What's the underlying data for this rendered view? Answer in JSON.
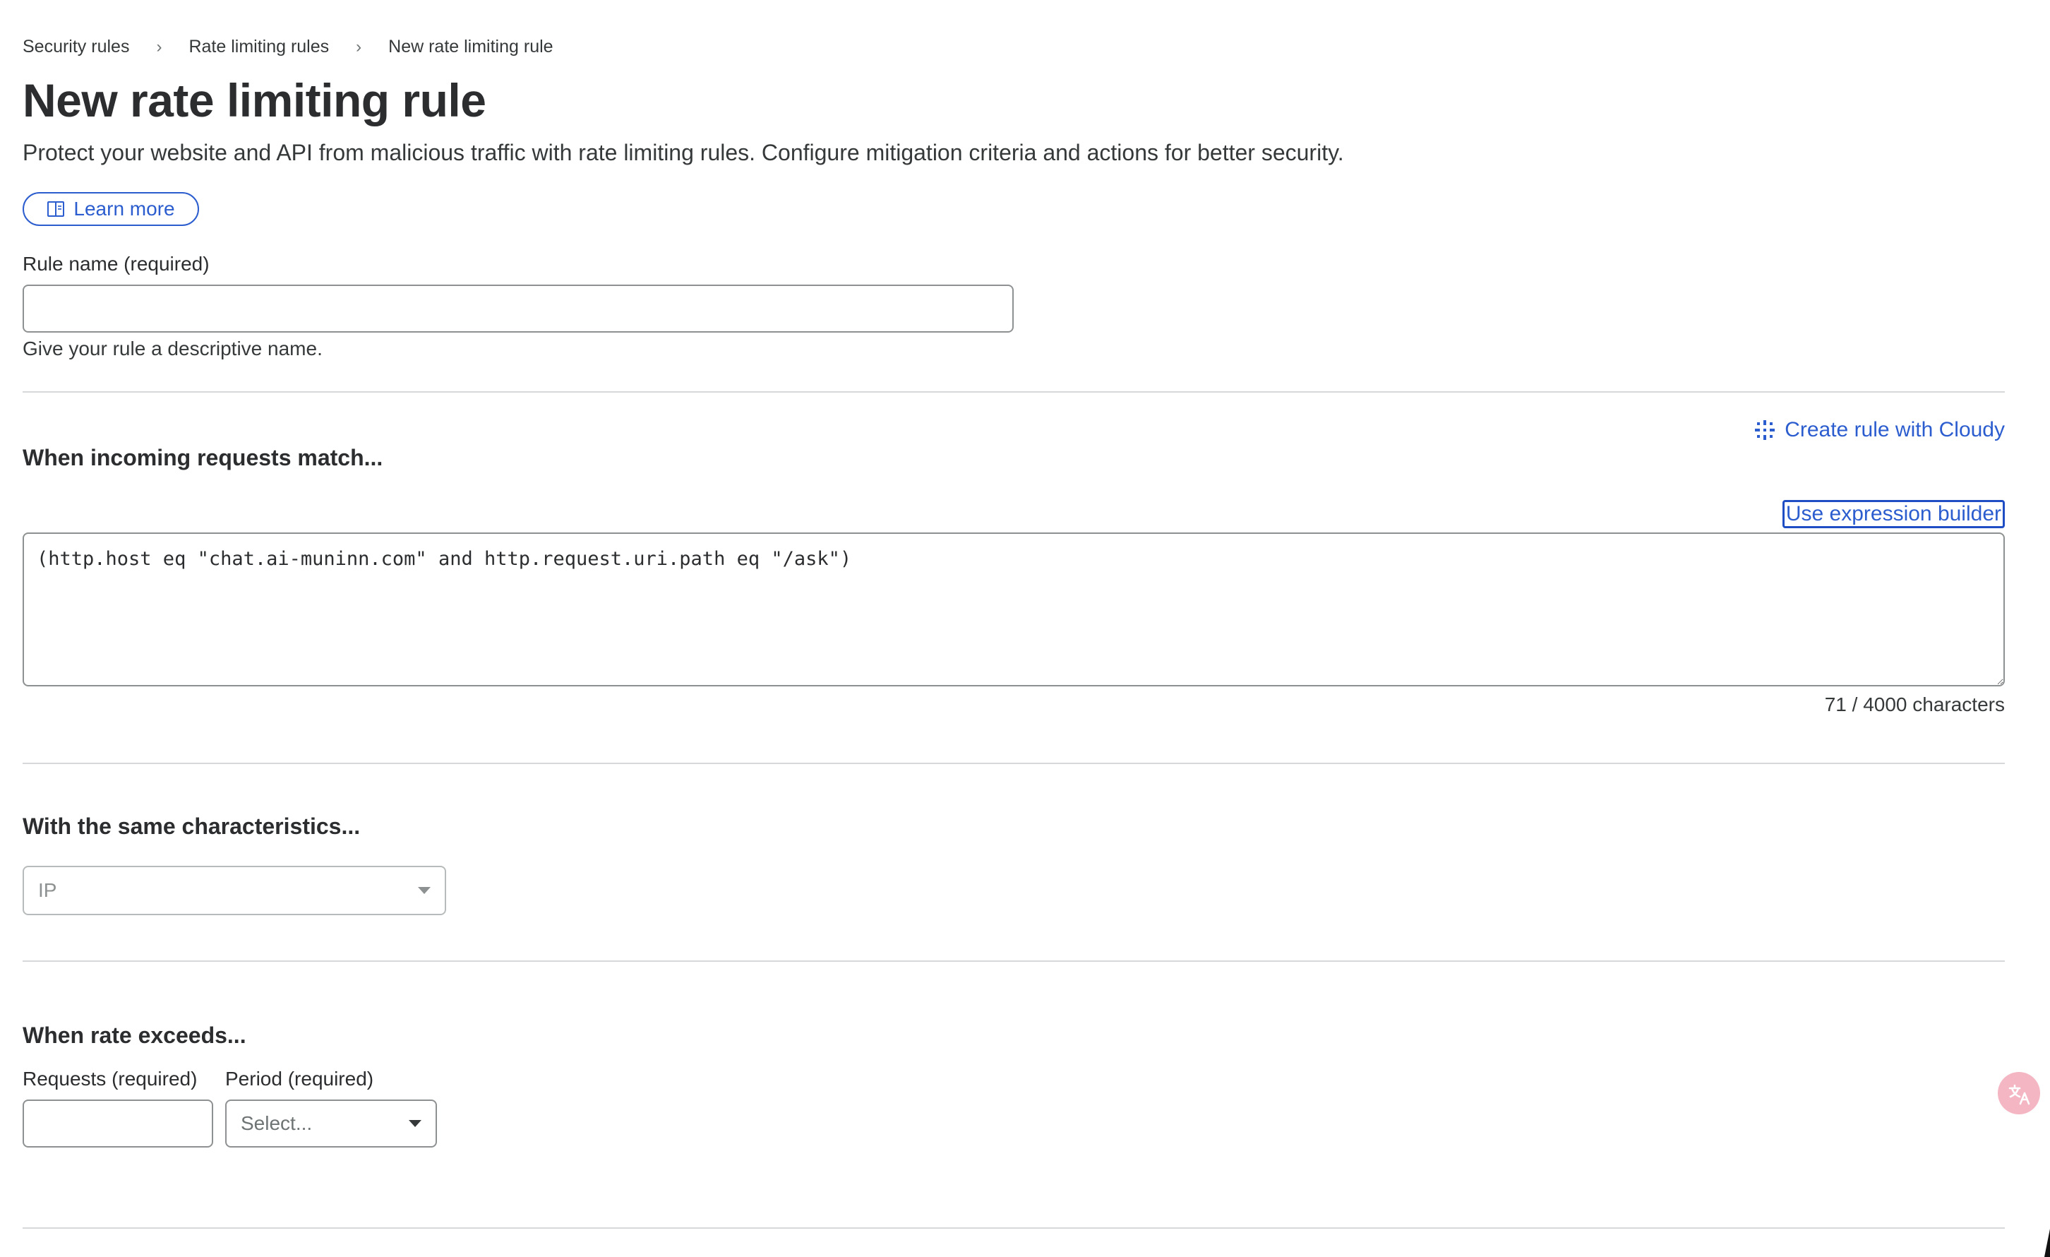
{
  "breadcrumb": {
    "items": [
      {
        "label": "Security rules"
      },
      {
        "label": "Rate limiting rules"
      },
      {
        "label": "New rate limiting rule"
      }
    ],
    "separator": "›"
  },
  "header": {
    "title": "New rate limiting rule",
    "description": "Protect your website and API from malicious traffic with rate limiting rules. Configure mitigation criteria and actions for better security.",
    "learn_more_label": "Learn more"
  },
  "rule_name": {
    "label": "Rule name (required)",
    "value": "",
    "helper": "Give your rule a descriptive name."
  },
  "match_section": {
    "title": "When incoming requests match...",
    "cloudy_link_label": "Create rule with Cloudy",
    "expression_builder_label": "Use expression builder",
    "expression": "(http.host eq \"chat.ai-muninn.com\" and http.request.uri.path eq \"/ask\")",
    "char_count": "71 / 4000 characters"
  },
  "characteristics_section": {
    "title": "With the same characteristics...",
    "selected_value": "IP"
  },
  "rate_section": {
    "title": "When rate exceeds...",
    "requests_label": "Requests (required)",
    "requests_value": "",
    "period_label": "Period (required)",
    "period_placeholder": "Select..."
  },
  "icons": {
    "learn_more": "book-icon",
    "cloudy": "sparkle-icon",
    "translate": "translate-icon"
  },
  "colors": {
    "accent": "#2c5dcf",
    "border": "#8e9192",
    "divider": "#d6d8d9",
    "fab": "#f3b6c2"
  }
}
